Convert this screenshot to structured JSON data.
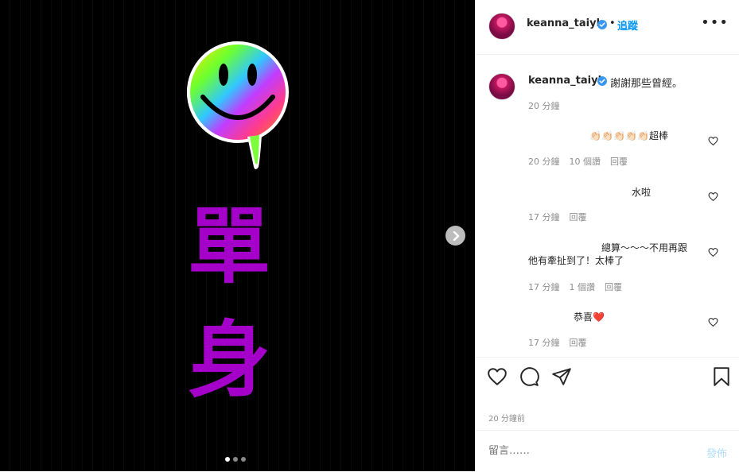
{
  "post": {
    "overlay_chars": [
      "單",
      "身"
    ],
    "carousel": {
      "dots": 3,
      "active": 0
    }
  },
  "header": {
    "username": "keanna_taiyh",
    "bullet": "•",
    "follow_label": "追蹤",
    "more_label": "•••"
  },
  "caption": {
    "username": "keanna_taiyh",
    "text": "謝謝那些曾經。",
    "time": "20 分鐘"
  },
  "comments": [
    {
      "text": "👏🏻👏🏻👏🏻👏🏻👏🏻超棒",
      "time": "20 分鐘",
      "replies": "10 個讚",
      "reply": "回覆"
    },
    {
      "text": "水啦",
      "time": "17 分鐘",
      "replies": "",
      "reply": "回覆"
    },
    {
      "text_line1": "總算～～～不用再跟",
      "text_line2": "他有牽扯到了！太棒了",
      "time": "17 分鐘",
      "replies": "1 個讚",
      "reply": "回覆"
    },
    {
      "text": "恭喜❤️",
      "time": "17 分鐘",
      "replies": "",
      "reply": "回覆"
    }
  ],
  "footer": {
    "time_ago": "20 分鐘前",
    "comment_placeholder": "留言……",
    "post_label": "發佈"
  },
  "colors": {
    "accent": "#0095f6",
    "overlay_text": "#a500c9",
    "post_disabled": "#b2dffc"
  }
}
